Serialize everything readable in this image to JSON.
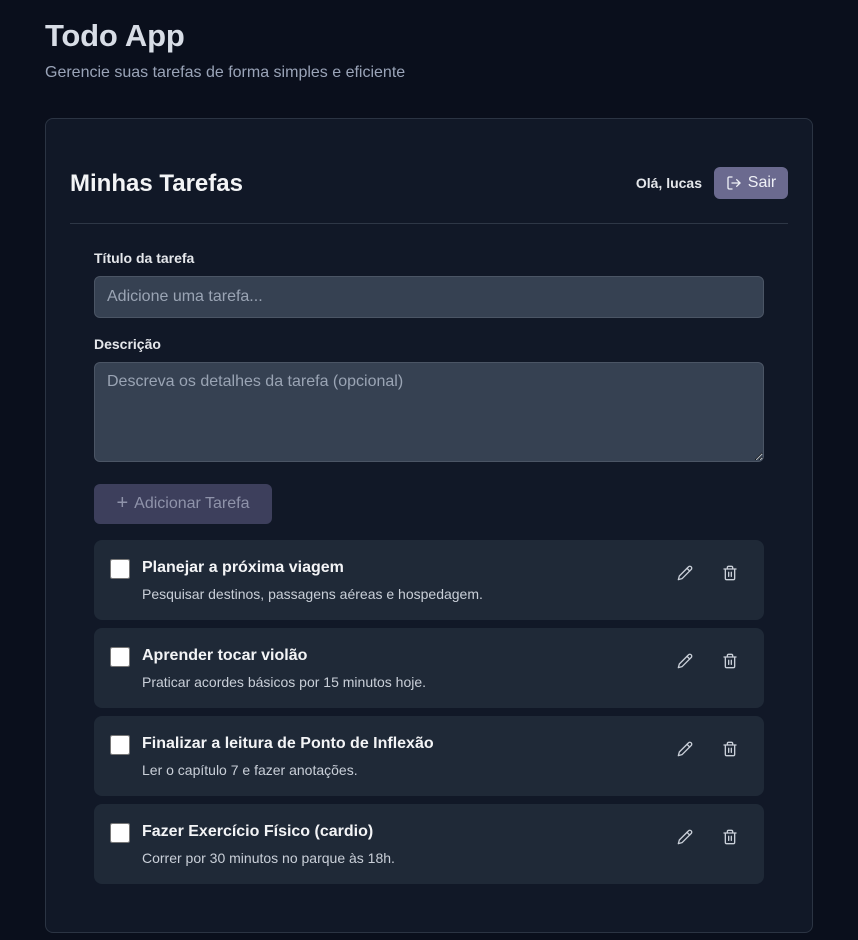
{
  "header": {
    "title": "Todo App",
    "subtitle": "Gerencie suas tarefas de forma simples e eficiente"
  },
  "card": {
    "title": "Minhas Tarefas",
    "greeting": "Olá, lucas",
    "logout_label": "Sair"
  },
  "form": {
    "title_label": "Título da tarefa",
    "title_value": "",
    "title_placeholder": "Adicione uma tarefa...",
    "description_label": "Descrição",
    "description_value": "",
    "description_placeholder": "Descreva os detalhes da tarefa (opcional)",
    "add_button_label": "Adicionar Tarefa"
  },
  "tasks": [
    {
      "title": "Planejar a próxima viagem",
      "description": "Pesquisar destinos, passagens aéreas e hospedagem.",
      "completed": false
    },
    {
      "title": "Aprender tocar violão",
      "description": "Praticar acordes básicos por 15 minutos hoje.",
      "completed": false
    },
    {
      "title": "Finalizar a leitura de Ponto de Inflexão",
      "description": "Ler o capítulo 7 e fazer anotações.",
      "completed": false
    },
    {
      "title": "Fazer Exercício Físico (cardio)",
      "description": "Correr por 30 minutos no parque às 18h.",
      "completed": false
    }
  ],
  "icons": {
    "logout": "logout-icon",
    "add": "plus-icon",
    "edit": "pencil-icon",
    "delete": "trash-icon"
  },
  "colors": {
    "background": "#0a0f1c",
    "card": "#111827",
    "task": "#1f2937",
    "accent": "#6b6a8f"
  }
}
